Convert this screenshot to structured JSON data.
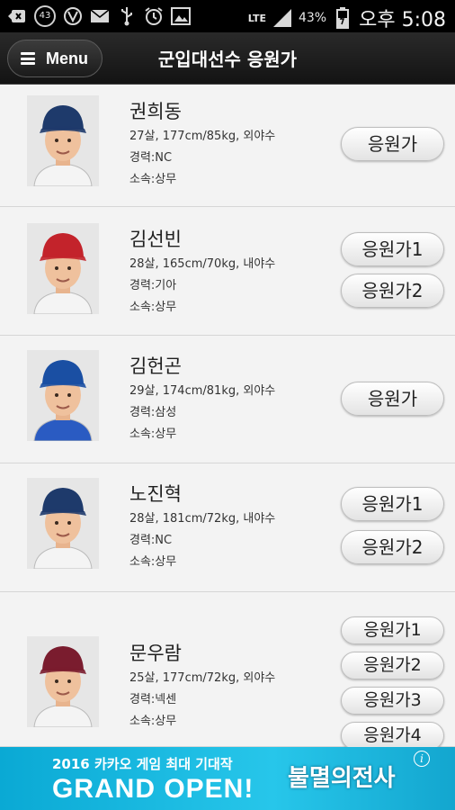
{
  "status_bar": {
    "notification_badge": "43",
    "network": "LTE",
    "battery": "43%",
    "time": "오후 5:08",
    "icons": [
      "back-arrow-icon",
      "vine-icon",
      "mail-icon",
      "usb-icon",
      "alarm-icon",
      "gallery-icon",
      "signal-icon",
      "battery-icon"
    ]
  },
  "header": {
    "menu_label": "Menu",
    "title": "군입대선수 응원가"
  },
  "players": [
    {
      "name": "권희동",
      "info": "27살, 177cm/85kg, 외야수",
      "career": "경력:NC",
      "affiliation": "소속:상무",
      "buttons": [
        "응원가"
      ],
      "cap_color": "#1e3a6b",
      "jersey_color": "#f4f4f4"
    },
    {
      "name": "김선빈",
      "info": "28살, 165cm/70kg, 내야수",
      "career": "경력:기아",
      "affiliation": "소속:상무",
      "buttons": [
        "응원가1",
        "응원가2"
      ],
      "cap_color": "#c3232b",
      "jersey_color": "#f4f4f4"
    },
    {
      "name": "김헌곤",
      "info": "29살, 174cm/81kg, 외야수",
      "career": "경력:삼성",
      "affiliation": "소속:상무",
      "buttons": [
        "응원가"
      ],
      "cap_color": "#1a4fa3",
      "jersey_color": "#2a5bc2"
    },
    {
      "name": "노진혁",
      "info": "28살, 181cm/72kg, 내야수",
      "career": "경력:NC",
      "affiliation": "소속:상무",
      "buttons": [
        "응원가1",
        "응원가2"
      ],
      "cap_color": "#1e3a6b",
      "jersey_color": "#f4f4f4"
    },
    {
      "name": "문우람",
      "info": "25살, 177cm/72kg, 외야수",
      "career": "경력:넥센",
      "affiliation": "소속:상무",
      "buttons": [
        "응원가1",
        "응원가2",
        "응원가3",
        "응원가4"
      ],
      "cap_color": "#7a1c2e",
      "jersey_color": "#f4f4f4"
    }
  ],
  "ad": {
    "line1": "2016 카카오 게임 최대 기대작",
    "line2": "GRAND OPEN!",
    "logo": "불멸의전사",
    "info_glyph": "i"
  }
}
